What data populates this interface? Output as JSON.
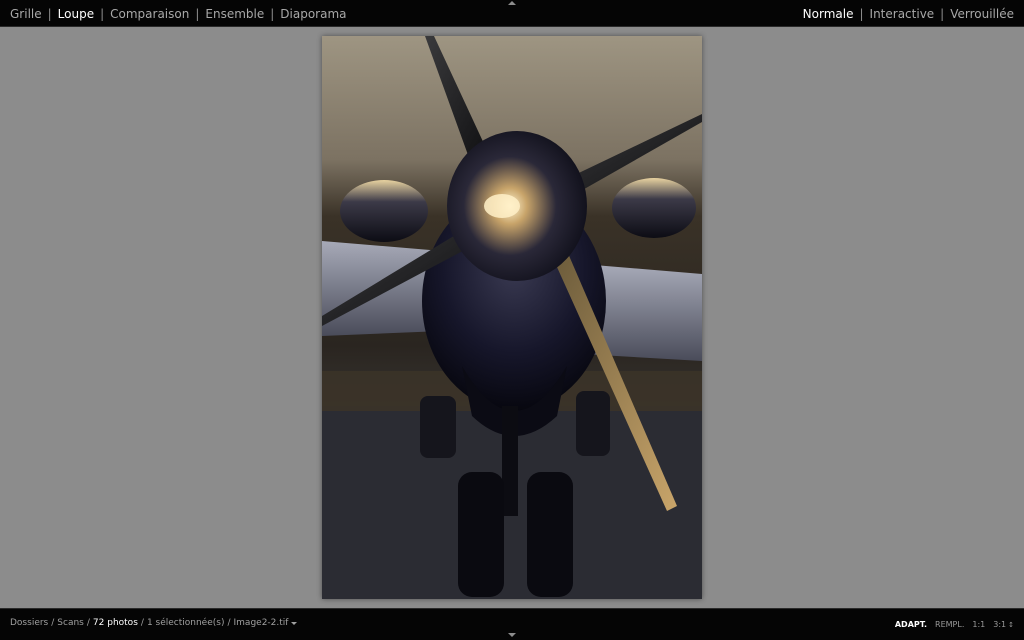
{
  "topbar": {
    "modes": [
      {
        "label": "Grille",
        "active": false
      },
      {
        "label": "Loupe",
        "active": true
      },
      {
        "label": "Comparaison",
        "active": false
      },
      {
        "label": "Ensemble",
        "active": false
      },
      {
        "label": "Diaporama",
        "active": false
      }
    ],
    "views": [
      {
        "label": "Normale",
        "active": true
      },
      {
        "label": "Interactive",
        "active": false
      },
      {
        "label": "Verrouillée",
        "active": false
      }
    ],
    "separator": "|"
  },
  "bottombar": {
    "path": {
      "folders": "Dossiers",
      "folder": "Scans",
      "count": "72 photos",
      "selection": "1 sélectionnée(s)",
      "file": "Image2-2.tif",
      "sep": "/"
    },
    "zoom": {
      "fit": "ADAPT.",
      "fill": "REMPL.",
      "one": "1:1",
      "three": "3:1"
    }
  },
  "photo": {
    "subject": "propeller-aircraft-nose"
  },
  "colors": {
    "bar": "#050505",
    "background": "#8c8c8c",
    "active_text": "#ffffff",
    "inactive_text": "#a8a8a8"
  }
}
